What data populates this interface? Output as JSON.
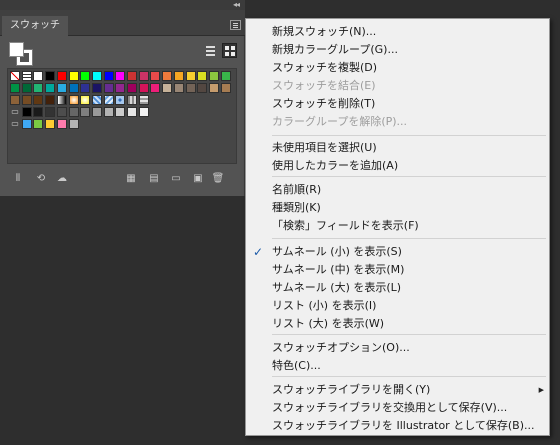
{
  "panel": {
    "collapse_glyph": "◂◂",
    "tab_label": "スウォッチ",
    "icons": {
      "menu": "panel-menu-icon",
      "list_view": "list-view-icon",
      "grid_view": "grid-view-icon"
    },
    "bottom_icons": [
      "swatch-libraries-icon",
      "show-swatch-kinds-icon",
      "cloud-library-icon",
      "swatch-options-icon",
      "color-group-icon",
      "new-color-group-icon",
      "new-swatch-icon",
      "delete-swatch-icon"
    ],
    "swatch_rows": [
      [
        "none",
        "registration",
        "#ffffff",
        "#000000",
        "#ff0000",
        "#ffff00",
        "#00ff00",
        "#00ffff",
        "#0000ff",
        "#ff00ff",
        "#cc3333",
        "#cc3366",
        "#e84a4a",
        "#f07a3c",
        "#f5a623",
        "#f7cf2f",
        "#d9e021",
        "#8cc63f",
        "#39b54a"
      ],
      [
        "#009245",
        "#006837",
        "#22b573",
        "#00a99d",
        "#29abe2",
        "#0071bc",
        "#2e3192",
        "#1b1464",
        "#662d91",
        "#93278f",
        "#9e005d",
        "#d4145a",
        "#ed1e79",
        "#c7b299",
        "#998675",
        "#736357",
        "#534741",
        "#c69c6d",
        "#a67c52"
      ],
      [
        "#8c6239",
        "#754c24",
        "#603813",
        "#42210b",
        "grad-bw",
        "grad-orange",
        "grad-yellow",
        "pattern-a",
        "pattern-b",
        "pattern-c",
        "pattern-d",
        "pattern-e"
      ],
      [
        "folder",
        "#000000",
        "#1a1a1a",
        "#333333",
        "#4d4d4d",
        "#666666",
        "#808080",
        "#999999",
        "#b3b3b3",
        "#cccccc",
        "#e6e6e6",
        "#f2f2f2"
      ],
      [
        "folder",
        "#3fa9f5",
        "#7ac943",
        "#ffcc33",
        "#ff7bac",
        "#b3b3b3"
      ]
    ]
  },
  "menu": {
    "items": [
      {
        "label": "新規スウォッチ(N)...",
        "disabled": false
      },
      {
        "label": "新規カラーグループ(G)...",
        "disabled": false
      },
      {
        "label": "スウォッチを複製(D)",
        "disabled": false
      },
      {
        "label": "スウォッチを結合(E)",
        "disabled": true
      },
      {
        "label": "スウォッチを削除(T)",
        "disabled": false
      },
      {
        "label": "カラーグループを解除(P)...",
        "disabled": true
      },
      {
        "label": "未使用項目を選択(U)",
        "disabled": false
      },
      {
        "label": "使用したカラーを追加(A)",
        "disabled": false
      },
      {
        "label": "名前順(R)",
        "disabled": false
      },
      {
        "label": "種類別(K)",
        "disabled": false
      },
      {
        "label": "「検索」フィールドを表示(F)",
        "disabled": false
      },
      {
        "label": "サムネール (小) を表示(S)",
        "disabled": false,
        "checked": true
      },
      {
        "label": "サムネール (中) を表示(M)",
        "disabled": false
      },
      {
        "label": "サムネール (大) を表示(L)",
        "disabled": false
      },
      {
        "label": "リスト (小) を表示(I)",
        "disabled": false
      },
      {
        "label": "リスト (大) を表示(W)",
        "disabled": false
      },
      {
        "label": "スウォッチオプション(O)...",
        "disabled": false
      },
      {
        "label": "特色(C)...",
        "disabled": false
      },
      {
        "label": "スウォッチライブラリを開く(Y)",
        "disabled": false,
        "submenu": true
      },
      {
        "label": "スウォッチライブラリを交換用として保存(V)...",
        "disabled": false
      },
      {
        "label": "スウォッチライブラリを Illustrator として保存(B)...",
        "disabled": false
      }
    ],
    "check_glyph": "✓",
    "submenu_glyph": "▶"
  }
}
